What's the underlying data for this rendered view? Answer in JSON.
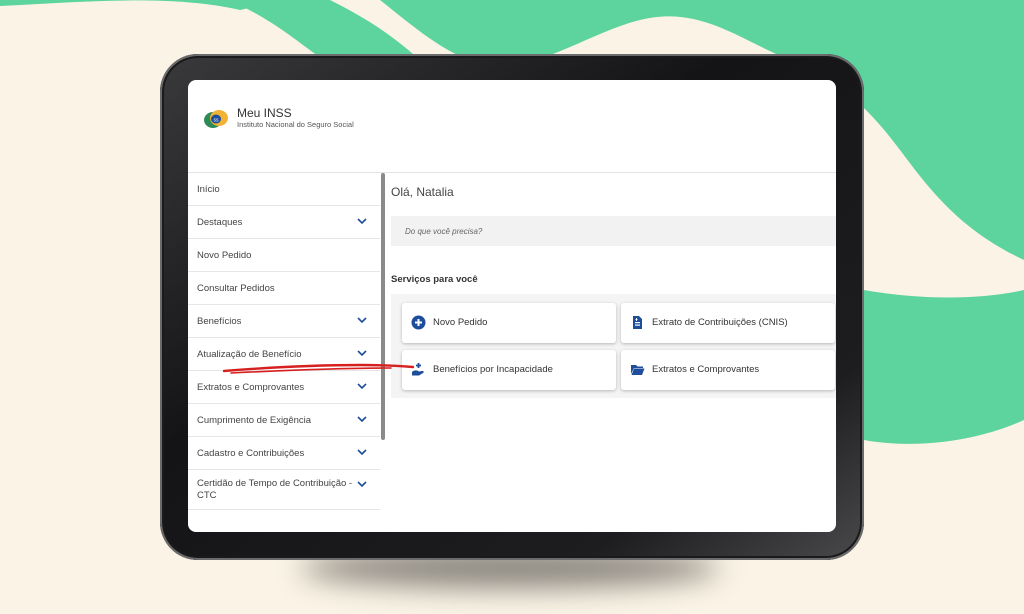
{
  "colors": {
    "wave_green": "#5DD39E",
    "background_cream": "#FBF4E6",
    "accent_blue": "#1E4E9B",
    "annotation_red": "#D62020"
  },
  "app": {
    "title": "Meu INSS",
    "subtitle": "Instituto Nacional do Seguro Social",
    "logo_icon": "inss-logo-icon"
  },
  "sidebar": {
    "items": [
      {
        "label": "Início",
        "has_chevron": false
      },
      {
        "label": "Destaques",
        "has_chevron": true
      },
      {
        "label": "Novo Pedido",
        "has_chevron": false
      },
      {
        "label": "Consultar Pedidos",
        "has_chevron": false
      },
      {
        "label": "Benefícios",
        "has_chevron": true
      },
      {
        "label": "Atualização de Benefício",
        "has_chevron": true
      },
      {
        "label": "Extratos e Comprovantes",
        "has_chevron": true
      },
      {
        "label": "Cumprimento de Exigência",
        "has_chevron": true
      },
      {
        "label": "Cadastro e Contribuições",
        "has_chevron": true
      },
      {
        "label": "Certidão de Tempo de Contribuição - CTC",
        "has_chevron": true
      }
    ]
  },
  "main": {
    "greeting": "Olá, Natalia",
    "search_placeholder": "Do que você precisa?",
    "services_heading": "Serviços para você",
    "services": [
      {
        "label": "Novo Pedido",
        "icon": "plus-circle-icon"
      },
      {
        "label": "Extrato de Contribuições (CNIS)",
        "icon": "document-icon"
      },
      {
        "label": "Benefícios por Incapacidade",
        "icon": "hand-plus-icon",
        "annotated": true
      },
      {
        "label": "Extratos e Comprovantes",
        "icon": "folder-open-icon"
      }
    ]
  }
}
